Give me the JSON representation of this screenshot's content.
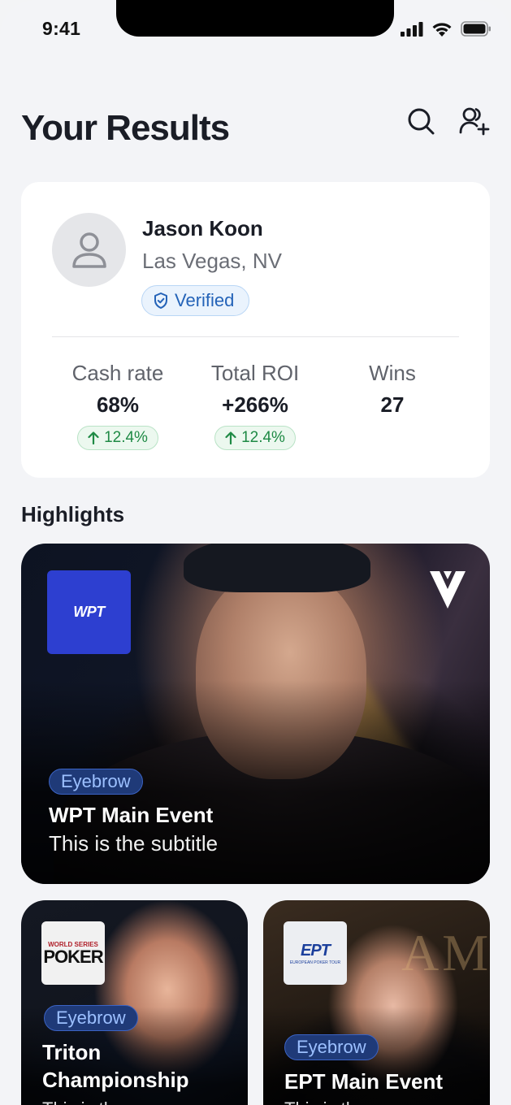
{
  "status_bar": {
    "time": "9:41"
  },
  "header": {
    "title": "Your Results"
  },
  "profile": {
    "name": "Jason Koon",
    "location": "Las Vegas, NV",
    "badge": "Verified",
    "stats": [
      {
        "label": "Cash rate",
        "value": "68%",
        "delta": "12.4%"
      },
      {
        "label": "Total ROI",
        "value": "+266%",
        "delta": "12.4%"
      },
      {
        "label": "Wins",
        "value": "27"
      }
    ]
  },
  "highlights": {
    "title": "Highlights",
    "featured": {
      "eyebrow": "Eyebrow",
      "title": "WPT Main Event",
      "subtitle": "This is the subtitle",
      "brand": "WPT"
    },
    "cards": [
      {
        "eyebrow": "Eyebrow",
        "title_line1": "Triton",
        "title_line2": "Championship",
        "subtitle": "This is the",
        "brand_top": "WORLD SERIES",
        "brand_main": "POKER"
      },
      {
        "eyebrow": "Eyebrow",
        "title": "EPT Main Event",
        "subtitle": "This is the",
        "brand": "EPT",
        "brand_sub": "EUROPEAN POKER TOUR",
        "bg_text": "AMON"
      }
    ]
  },
  "colors": {
    "accent_blue": "#2463b8",
    "positive_green": "#1f8a45",
    "wpt_blue": "#2d3fd0"
  },
  "icons": [
    "search-icon",
    "add-user-icon",
    "user-icon",
    "shield-check-icon",
    "arrow-up-icon",
    "v-logo-icon"
  ]
}
